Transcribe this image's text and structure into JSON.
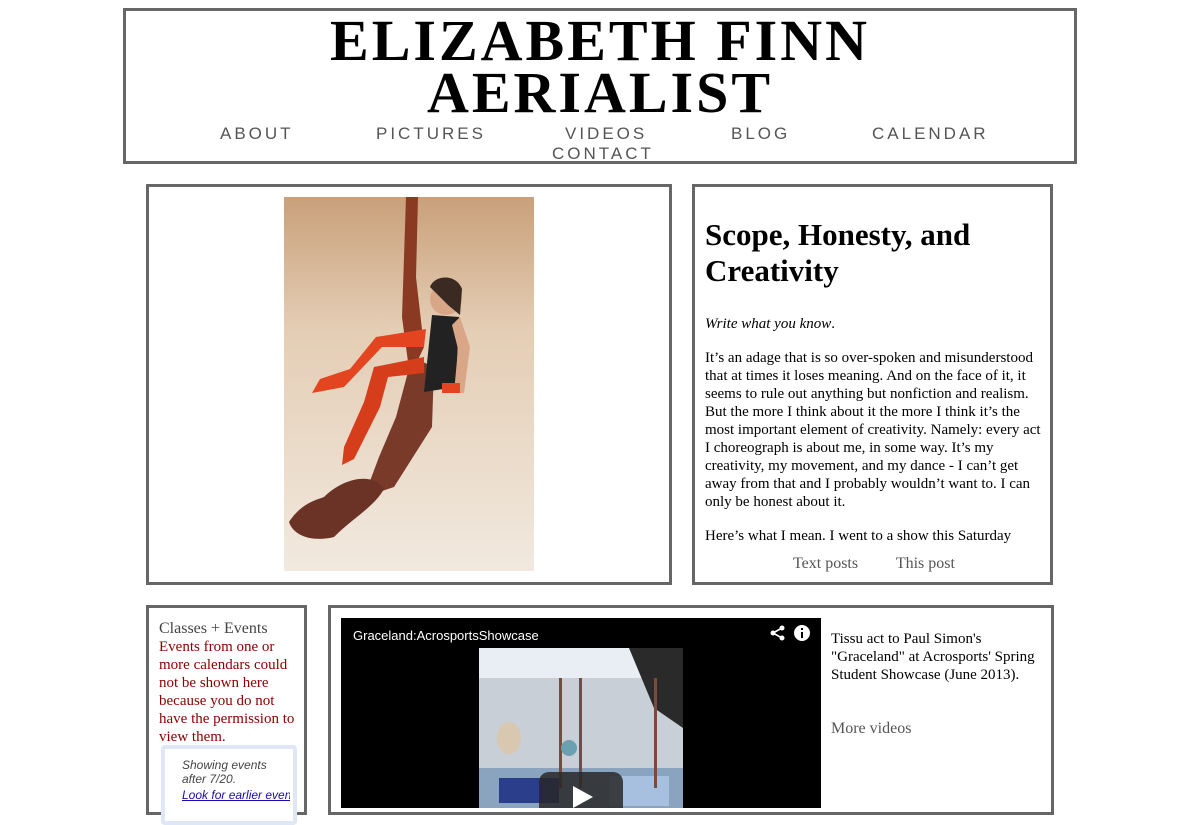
{
  "header": {
    "title_line1": "ELIZABETH FINN",
    "title_line2": "AERIALIST",
    "nav": [
      "ABOUT",
      "PICTURES",
      "VIDEOS",
      "BLOG",
      "CALENDAR",
      "CONTACT"
    ]
  },
  "blog": {
    "title": "Scope, Honesty, and Creativity",
    "intro_italic": "Write what you know",
    "intro_suffix": ".",
    "paragraph": "It’s an adage that is so over-spoken and misunderstood that at times it loses meaning. And on the face of it, it seems to rule out anything but nonfiction and realism. But the more I think about it the more I think it’s the most important element of creativity. Namely: every act I choreograph is about me, in some way. It’s my creativity, my movement, and my dance - I can’t get away from that and I probably wouldn’t want to. I can only be honest about it.",
    "paragraph2": "Here’s what I mean. I went to a show this Saturday",
    "footer_text_posts": "Text posts",
    "footer_this_post": "This post"
  },
  "calendar": {
    "title": "Classes + Events",
    "error": "Events from one or more calendars could not be shown here because you do not have the permission to view them.",
    "showing": "Showing events after 7/20.",
    "earlier_link": "Look for earlier events"
  },
  "video": {
    "title": "Graceland:AcrosportsShowcase",
    "description": "Tissu act to Paul Simon's \"Graceland\" at Acrosports' Spring Student Showcase (June 2013).",
    "more": "More videos"
  }
}
